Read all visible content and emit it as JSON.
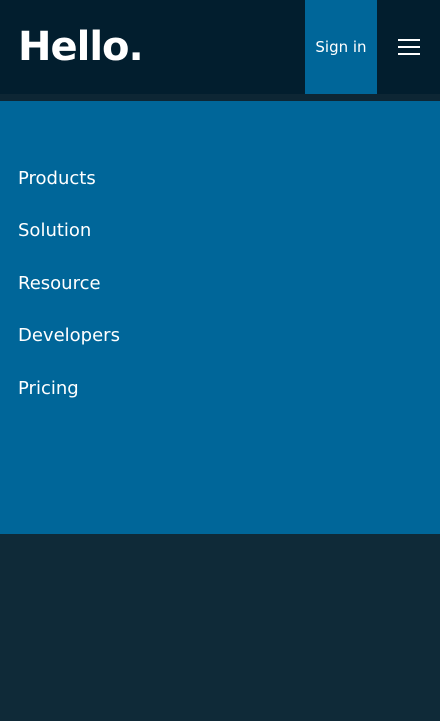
{
  "header": {
    "logo_text": "Hello.",
    "signin_label": "Sign in",
    "menu_icon": "hamburger-menu-icon"
  },
  "nav": {
    "items": [
      {
        "label": "Products"
      },
      {
        "label": "Solution"
      },
      {
        "label": "Resource"
      },
      {
        "label": "Developers"
      },
      {
        "label": "Pricing"
      }
    ]
  },
  "colors": {
    "header_bg": "#021e2e",
    "accent": "#006699",
    "page_bg": "#0f2a38",
    "text": "#ffffff"
  }
}
